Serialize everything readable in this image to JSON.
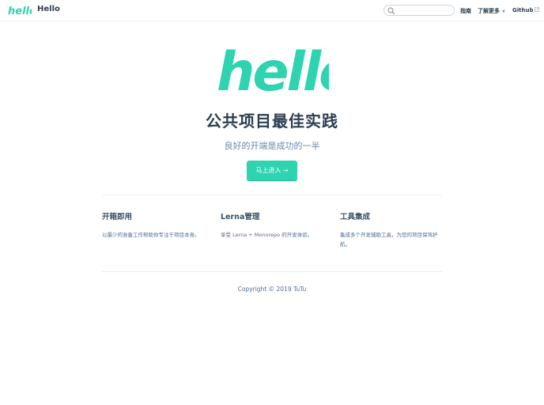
{
  "nav": {
    "logo_text": "hello",
    "site_title": "Hello",
    "search_placeholder": "",
    "links": [
      {
        "label": "指南"
      },
      {
        "label": "了解更多"
      },
      {
        "label": "Github"
      }
    ]
  },
  "hero": {
    "logo_text": "hello",
    "title": "公共项目最佳实践",
    "description": "良好的开端是成功的一半",
    "action_label": "马上进入 →"
  },
  "features": [
    {
      "title": "开箱即用",
      "details": "以最少的准备工作帮助你专注于项目本身。"
    },
    {
      "title": "Lerna管理",
      "details": "享受 Lerna + Monorepo 的开发体验。"
    },
    {
      "title": "工具集成",
      "details": "集成多个开发辅助工具，为您的项目保驾护航。"
    }
  ],
  "footer": {
    "text": "Copyright © 2019 TuTu"
  },
  "colors": {
    "accent": "#2ed3b0",
    "text": "#2c3e50"
  }
}
